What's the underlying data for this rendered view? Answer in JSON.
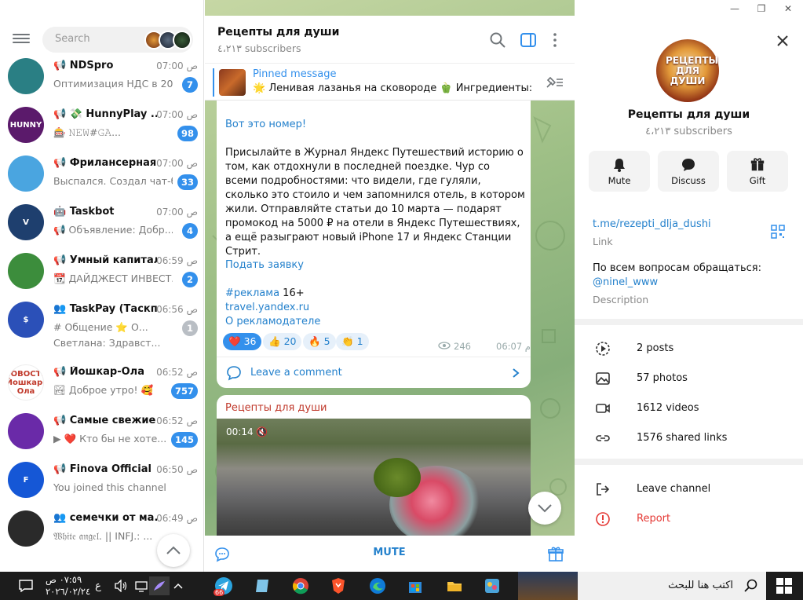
{
  "search": {
    "placeholder": "Search"
  },
  "chats": [
    {
      "name": "📢 NDSpro",
      "time": "07:00 ص",
      "preview": "Оптимизация НДС в 20...",
      "badge": "7",
      "avatar_color": "#2a7f84",
      "avatar_text": ""
    },
    {
      "name": "📢 💸 HunnyPlay ...",
      "time": "07:00 ص",
      "preview": "🎰 𝙽𝙴𝚆#𝙶𝙰...",
      "badge": "98",
      "avatar_color": "#5b1a6b",
      "avatar_text": "HUNNY"
    },
    {
      "name": "📢 Фрилансерная",
      "time": "07:00 ص",
      "preview": "Выспался. Создал чат-б...",
      "badge": "33",
      "avatar_color": "#4aa5e0",
      "avatar_text": ""
    },
    {
      "name": "🤖 Taskbot",
      "time": "07:00 ص",
      "preview": "📢 Объявление: Добр...",
      "badge": "4",
      "avatar_color": "#1e3f6e",
      "avatar_text": "V"
    },
    {
      "name": "📢 Умный капитал",
      "time": "06:59 ص",
      "preview": "📆 ДАЙДЖЕСТ ИНВЕСТ...",
      "badge": "2",
      "avatar_color": "#3c8d3c",
      "avatar_text": ""
    },
    {
      "name": "👥 TaskPay (Таскп...",
      "time": "06:56 ص",
      "preview": "# Общение ⭐ О...",
      "preview2": "Светлана: Здравст...",
      "badge": "1",
      "badge_grey": true,
      "avatar_color": "#2b50b8",
      "avatar_text": "$"
    },
    {
      "name": "📢 Йошкар-Ола",
      "time": "06:52 ص",
      "preview": "🏞 Доброе утро! 🥰",
      "badge": "757",
      "avatar_color": "#ffffff",
      "avatar_text": "НОВОСТИ Йошкар-Ола"
    },
    {
      "name": "📢 Самые свежие ...",
      "time": "06:52 ص",
      "preview": "▶ ❤️ Кто бы не хоте...",
      "badge": "145",
      "avatar_color": "#6a2aa8",
      "avatar_text": ""
    },
    {
      "name": "📢 Finova Official",
      "time": "06:50 ص",
      "preview": "You joined this channel",
      "badge": "",
      "avatar_color": "#1557d6",
      "avatar_text": "F"
    },
    {
      "name": "👥 семечки от ма...",
      "time": "06:49 ص",
      "preview": "𝔚𝔥𝔦𝔱𝔢 𝔞𝔫𝔤𝔢𝔩. || INFJ.: ...",
      "badge": "",
      "avatar_color": "#2a2a2a",
      "avatar_text": ""
    }
  ],
  "channel": {
    "title": "Рецепты для души",
    "subscribers": "٤،٢١٣ subscribers"
  },
  "pinned": {
    "label": "Pinned message",
    "text": "🌟 Ленивая лазанья на сковороде 🫑 Ингредиенты: ..."
  },
  "message1": {
    "header": "Вот это номер!",
    "body": "Присылайте в Журнал Яндекс Путешествий историю о том, как отдохнули в последней поездке. Чур со всеми подробностями: что видели, где гуляли, сколько это стоило и чем запомнился отель, в котором жили. Отправляйте статьи до 10 марта — подарят промокод на 5000 ₽ на отели в Яндекс Путешествиях, а ещё разыграют новый iPhone 17 и Яндекс Станции Стрит.",
    "apply": "Подать заявку",
    "tag": "#реклама",
    "tag_suffix": " 16+",
    "link1": "travel.yandex.ru",
    "link2": "О рекламодателе",
    "reactions": [
      {
        "emoji": "❤️",
        "count": "36"
      },
      {
        "emoji": "👍",
        "count": "20"
      },
      {
        "emoji": "🔥",
        "count": "5"
      },
      {
        "emoji": "👏",
        "count": "1"
      }
    ],
    "views": "246",
    "time": "06:07 م",
    "comment": "Leave a comment"
  },
  "message2": {
    "author": "Рецепты для души",
    "video_time": "00:14"
  },
  "bottom": {
    "mute": "MUTE"
  },
  "profile": {
    "avatar_text": "РЕЦЕПТЫ ДЛЯ ДУШИ",
    "name": "Рецепты для души",
    "subscribers": "٤،٢١٣ subscribers",
    "buttons": [
      {
        "label": "Mute",
        "icon": "bell-icon"
      },
      {
        "label": "Discuss",
        "icon": "chat-bubble-icon"
      },
      {
        "label": "Gift",
        "icon": "gift-icon"
      }
    ],
    "link": "t.me/rezepti_dlja_dushi",
    "link_label": "Link",
    "desc_line1": "По всем вопросам обращаться:",
    "desc_line2": "@ninel_www",
    "desc_label": "Description",
    "media": [
      {
        "label": "2 posts",
        "icon": "posts-icon"
      },
      {
        "label": "57 photos",
        "icon": "photo-icon"
      },
      {
        "label": "1612 videos",
        "icon": "video-icon"
      },
      {
        "label": "1576 shared links",
        "icon": "link-icon"
      }
    ],
    "leave": "Leave channel",
    "report": "Report",
    "report_color": "#e53935"
  },
  "taskbar": {
    "time": "٠٧:٥٩ ص",
    "date": "٢٠٢٦/٠٢/٢٤",
    "lang": "ع",
    "search_text": "اكتب هنا للبحث",
    "telegram_badge": "66"
  },
  "colors": {
    "accent": "#3390ec",
    "link": "#2481cc"
  }
}
